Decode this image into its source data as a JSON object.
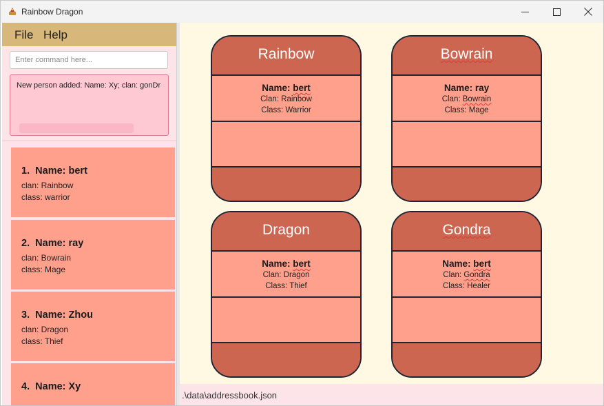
{
  "window": {
    "title": "Rainbow Dragon",
    "controls": {
      "minimize_icon": "minimize-icon",
      "maximize_icon": "maximize-icon",
      "close_icon": "close-icon"
    }
  },
  "menu": {
    "file_label": "File",
    "help_label": "Help"
  },
  "command": {
    "placeholder": "Enter command here...",
    "value": ""
  },
  "result": {
    "text": "New person added: Name: Xy; clan: gonDr"
  },
  "persons": [
    {
      "index": "1.",
      "name": "Name: bert",
      "clan": "clan: Rainbow",
      "class": "class: warrior"
    },
    {
      "index": "2.",
      "name": "Name: ray",
      "clan": "clan: Bowrain",
      "class": "class: Mage"
    },
    {
      "index": "3.",
      "name": "Name: Zhou",
      "clan": "clan: Dragon",
      "class": "class: Thief"
    },
    {
      "index": "4.",
      "name": "Name: Xy",
      "clan": "",
      "class": ""
    }
  ],
  "clans": [
    {
      "title": "Rainbow",
      "member": {
        "name_label": "Name:",
        "name": "bert",
        "clan_label": "Clan:",
        "clan": "Rainbow",
        "class_label": "Class:",
        "class": "Warrior"
      }
    },
    {
      "title": "Bowrain",
      "member": {
        "name_label": "Name:",
        "name": "ray",
        "clan_label": "Clan:",
        "clan": "Bowrain",
        "class_label": "Class:",
        "class": "Mage"
      }
    },
    {
      "title": "Dragon",
      "member": {
        "name_label": "Name:",
        "name": "bert",
        "clan_label": "Clan:",
        "clan": "Dragon",
        "class_label": "Class:",
        "class": "Thief"
      }
    },
    {
      "title": "Gondra",
      "member": {
        "name_label": "Name:",
        "name": "bert",
        "clan_label": "Clan:",
        "clan": "Gondra",
        "class_label": "Class:",
        "class": "Healer"
      }
    }
  ],
  "status": {
    "path": ".\\data\\addressbook.json"
  },
  "colors": {
    "menubar": "#d7b77a",
    "card_fill": "#ffa08d",
    "card_header": "#cd6650",
    "right_pane_bg": "#fff8e3",
    "left_pane_bg": "#fde4e8",
    "result_bg": "#ffc9d3"
  }
}
